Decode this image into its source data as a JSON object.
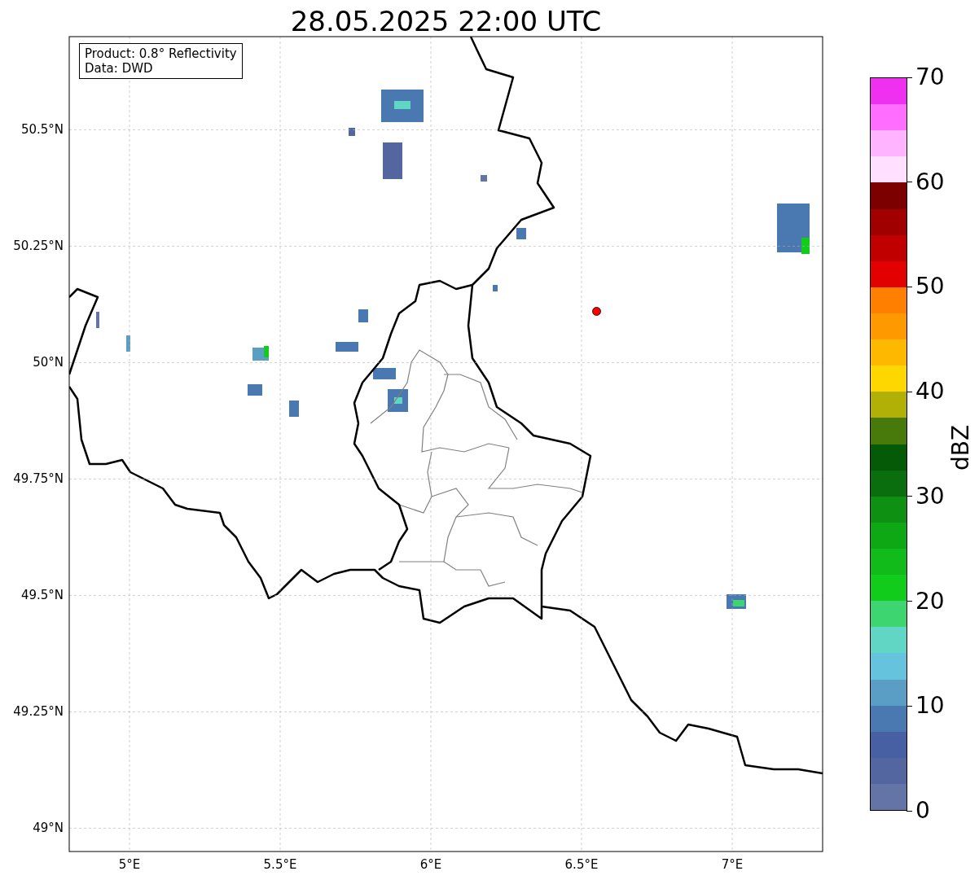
{
  "title": "28.05.2025 22:00 UTC",
  "info_box": [
    "Product: 0.8° Reflectivity",
    "Data: DWD"
  ],
  "map": {
    "chart_data": {
      "type": "scatter",
      "grid": true,
      "xlim": [
        4.8,
        7.3
      ],
      "ylim": [
        48.95,
        50.7
      ],
      "xticks": [
        {
          "value": 5,
          "label": "5°E"
        },
        {
          "value": 5.5,
          "label": "5.5°E"
        },
        {
          "value": 6,
          "label": "6°E"
        },
        {
          "value": 6.5,
          "label": "6.5°E"
        },
        {
          "value": 7,
          "label": "7°E"
        }
      ],
      "yticks": [
        {
          "value": 50.5,
          "label": "50.5°N"
        },
        {
          "value": 50.25,
          "label": "50.25°N"
        },
        {
          "value": 50,
          "label": "50°N"
        },
        {
          "value": 49.75,
          "label": "49.75°N"
        },
        {
          "value": 49.5,
          "label": "49.5°N"
        },
        {
          "value": 49.25,
          "label": "49.25°N"
        },
        {
          "value": 49,
          "label": "49°N"
        }
      ],
      "series": [
        {
          "color": "#ff0000",
          "x": [
            6.55
          ],
          "values": [
            50.11
          ]
        }
      ]
    }
  },
  "colorbar": {
    "label": "dBZ",
    "ticks": [
      "70",
      "60",
      "50",
      "40",
      "30",
      "20",
      "10",
      "0"
    ],
    "bands": [
      {
        "color": "#f030f0"
      },
      {
        "color": "#ff6eff"
      },
      {
        "color": "#ffb4ff"
      },
      {
        "color": "#ffe0ff"
      },
      {
        "color": "#7d0000"
      },
      {
        "color": "#a00000"
      },
      {
        "color": "#c00000"
      },
      {
        "color": "#e30000"
      },
      {
        "color": "#ff7f00"
      },
      {
        "color": "#ff9900"
      },
      {
        "color": "#ffb800"
      },
      {
        "color": "#ffd700"
      },
      {
        "color": "#b0b007"
      },
      {
        "color": "#477a0a"
      },
      {
        "color": "#055a08"
      },
      {
        "color": "#0a6e0e"
      },
      {
        "color": "#0e9012"
      },
      {
        "color": "#0fa815"
      },
      {
        "color": "#10bb1a"
      },
      {
        "color": "#11cc1a"
      },
      {
        "color": "#3dd56f"
      },
      {
        "color": "#62d6c4"
      },
      {
        "color": "#66c3dd"
      },
      {
        "color": "#5a9ec6"
      },
      {
        "color": "#4a78b0"
      },
      {
        "color": "#4660a3"
      },
      {
        "color": "#5366a0"
      },
      {
        "color": "#6474a6"
      }
    ]
  }
}
